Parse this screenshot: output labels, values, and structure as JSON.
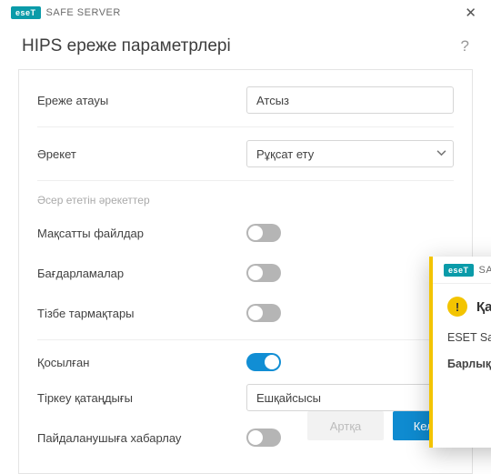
{
  "app": {
    "brand_badge": "eseT",
    "product": "SAFE SERVER"
  },
  "dialog": {
    "title": "HIPS ереже параметрлері",
    "help_glyph": "?"
  },
  "rule_name": {
    "label": "Ереже атауы",
    "value": "Атсыз"
  },
  "action": {
    "label": "Әрекет",
    "value": "Рұқсат ету"
  },
  "operations": {
    "title": "Әсер ететін әрекеттер",
    "target_files": {
      "label": "Мақсатты файлдар",
      "on": false
    },
    "applications": {
      "label": "Бағдарламалар",
      "on": false
    },
    "registry": {
      "label": "Тізбе тармақтары",
      "on": false
    }
  },
  "enabled": {
    "label": "Қосылған",
    "on": true
  },
  "severity": {
    "label": "Тіркеу қатаңдығы",
    "value": "Ешқайсысы"
  },
  "notify": {
    "label": "Пайдаланушыға хабарлау",
    "on": false
  },
  "footer": {
    "back": "Артқа",
    "next": "Келесі"
  },
  "popup": {
    "product": "SAFE SER",
    "title": "Қайта іс",
    "line1": "ESET Safe қосыңыз.",
    "line2": "Барлық үшін ком"
  }
}
